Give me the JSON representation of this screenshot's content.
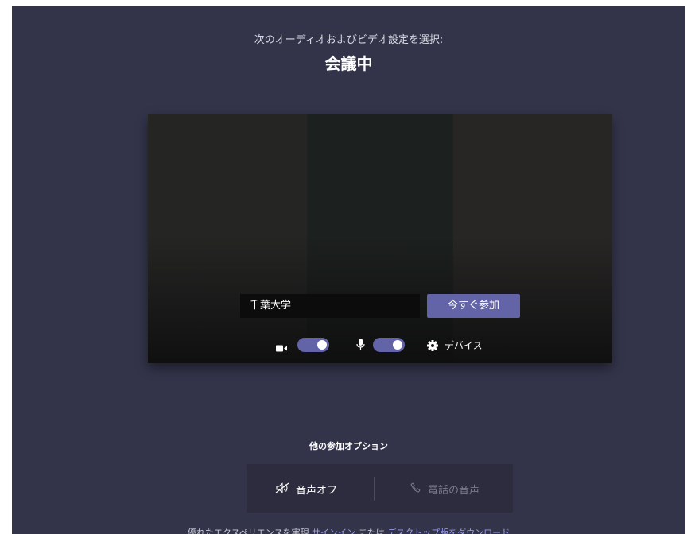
{
  "header": {
    "subtitle": "次のオーディオおよびビデオ設定を選択:",
    "title": "会議中"
  },
  "preview": {
    "name_value": "千葉大学",
    "join_label": "今すぐ参加",
    "camera_on": true,
    "mic_on": true,
    "device_label": "デバイス",
    "accent_color": "#6264a7"
  },
  "other_options": {
    "title": "他の参加オプション",
    "audio_off_label": "音声オフ",
    "phone_audio_label": "電話の音声"
  },
  "footer": {
    "prefix": "優れたエクスペリエンスを実現",
    "sign_in_link": "サインイン",
    "or_text": "または",
    "download_link": "デスクトップ版をダウンロード"
  }
}
